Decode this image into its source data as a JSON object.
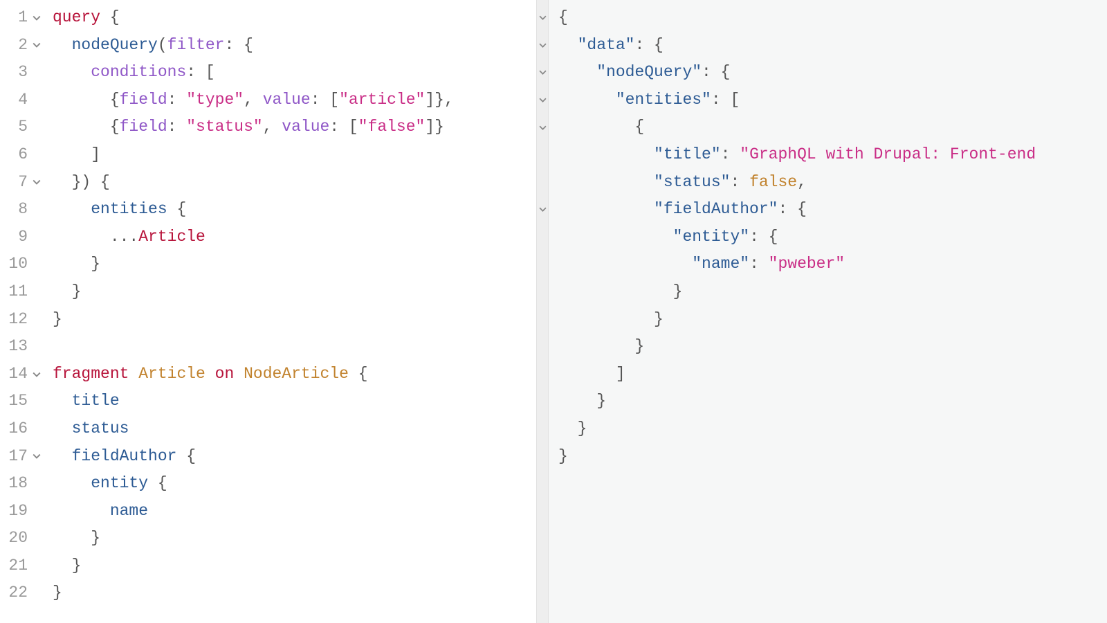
{
  "left": {
    "line_count": 22,
    "fold_markers": [
      1,
      2,
      7,
      14,
      17
    ],
    "tokens": {
      "l1": {
        "a": "query",
        "b": " {"
      },
      "l2": {
        "a": "  ",
        "b": "nodeQuery",
        "c": "(",
        "d": "filter",
        "e": ": {"
      },
      "l3": {
        "a": "    ",
        "b": "conditions",
        "c": ": ["
      },
      "l4": {
        "a": "      {",
        "b": "field",
        "c": ": ",
        "d": "\"type\"",
        "e": ", ",
        "f": "value",
        "g": ": [",
        "h": "\"article\"",
        "i": "]},"
      },
      "l5": {
        "a": "      {",
        "b": "field",
        "c": ": ",
        "d": "\"status\"",
        "e": ", ",
        "f": "value",
        "g": ": [",
        "h": "\"false\"",
        "i": "]}"
      },
      "l6": {
        "a": "    ]"
      },
      "l7": {
        "a": "  }) {"
      },
      "l8": {
        "a": "    ",
        "b": "entities",
        "c": " {"
      },
      "l9": {
        "a": "      ...",
        "b": "Article"
      },
      "l10": {
        "a": "    }"
      },
      "l11": {
        "a": "  }"
      },
      "l12": {
        "a": "}"
      },
      "l13": {
        "a": ""
      },
      "l14": {
        "a": "fragment",
        "b": " ",
        "c": "Article",
        "d": " ",
        "e": "on",
        "f": " ",
        "g": "NodeArticle",
        "h": " {"
      },
      "l15": {
        "a": "  ",
        "b": "title"
      },
      "l16": {
        "a": "  ",
        "b": "status"
      },
      "l17": {
        "a": "  ",
        "b": "fieldAuthor",
        "c": " {"
      },
      "l18": {
        "a": "    ",
        "b": "entity",
        "c": " {"
      },
      "l19": {
        "a": "      ",
        "b": "name"
      },
      "l20": {
        "a": "    }"
      },
      "l21": {
        "a": "  }"
      },
      "l22": {
        "a": "}"
      }
    }
  },
  "right": {
    "fold_markers": [
      1,
      2,
      3,
      4,
      5,
      8
    ],
    "tokens": {
      "r1": {
        "a": "{"
      },
      "r2": {
        "a": "  ",
        "b": "\"data\"",
        "c": ": {"
      },
      "r3": {
        "a": "    ",
        "b": "\"nodeQuery\"",
        "c": ": {"
      },
      "r4": {
        "a": "      ",
        "b": "\"entities\"",
        "c": ": ["
      },
      "r5": {
        "a": "        {"
      },
      "r6": {
        "a": "          ",
        "b": "\"title\"",
        "c": ": ",
        "d": "\"GraphQL with Drupal: Front-end"
      },
      "r7": {
        "a": "          ",
        "b": "\"status\"",
        "c": ": ",
        "d": "false",
        "e": ","
      },
      "r8": {
        "a": "          ",
        "b": "\"fieldAuthor\"",
        "c": ": {"
      },
      "r9": {
        "a": "            ",
        "b": "\"entity\"",
        "c": ": {"
      },
      "r10": {
        "a": "              ",
        "b": "\"name\"",
        "c": ": ",
        "d": "\"pweber\""
      },
      "r11": {
        "a": "            }"
      },
      "r12": {
        "a": "          }"
      },
      "r13": {
        "a": "        }"
      },
      "r14": {
        "a": "      ]"
      },
      "r15": {
        "a": "    }"
      },
      "r16": {
        "a": "  }"
      },
      "r17": {
        "a": "}"
      }
    }
  }
}
